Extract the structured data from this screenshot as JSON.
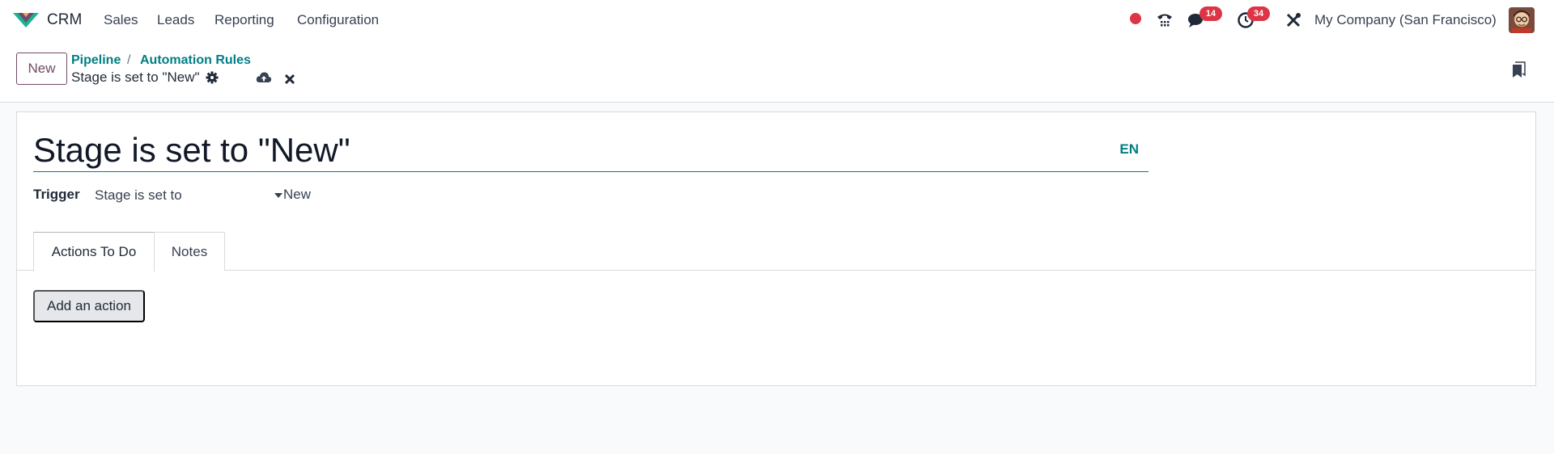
{
  "navbar": {
    "app_name": "CRM",
    "menu": [
      "Sales",
      "Leads",
      "Reporting",
      "Configuration"
    ],
    "messages_badge": "14",
    "activities_badge": "34",
    "company": "My Company (San Francisco)",
    "brand_color": "#714b67",
    "badge_color": "#dc3545"
  },
  "control_panel": {
    "new_label": "New",
    "breadcrumbs": [
      "Pipeline",
      "Automation Rules"
    ],
    "breadcrumb_separator": "/",
    "record_name": "Stage is set to \"New\""
  },
  "form": {
    "title": "Stage is set to \"New\"",
    "lang": "EN",
    "trigger_label": "Trigger",
    "trigger_value": "Stage is set to",
    "trigger_stage": "New",
    "tabs": [
      "Actions To Do",
      "Notes"
    ],
    "add_action_label": "Add an action",
    "accent_color": "#017e84"
  }
}
